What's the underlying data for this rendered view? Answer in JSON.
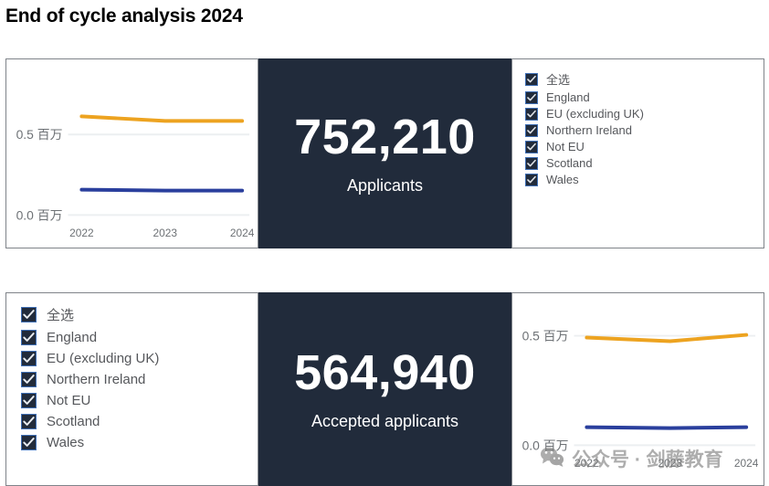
{
  "page": {
    "title": "End of cycle analysis 2024"
  },
  "kpis": [
    {
      "value": "752,210",
      "label": "Applicants"
    },
    {
      "value": "564,940",
      "label": "Accepted applicants"
    }
  ],
  "filter": {
    "items": [
      {
        "label": "全选",
        "checked": true
      },
      {
        "label": "England",
        "checked": true
      },
      {
        "label": "EU (excluding UK)",
        "checked": true
      },
      {
        "label": "Northern Ireland",
        "checked": true
      },
      {
        "label": "Not EU",
        "checked": true
      },
      {
        "label": "Scotland",
        "checked": true
      },
      {
        "label": "Wales",
        "checked": true
      }
    ]
  },
  "watermark": {
    "text": "公众号 · 剑藤教育",
    "icon": "wechat-icon"
  },
  "colors": {
    "panel_dark": "#212b3b",
    "series_applicants": "#eda320",
    "series_accepted": "#2a3f9d",
    "axis_text": "#6d7175",
    "gridline": "#eceff1"
  },
  "chart_data": [
    {
      "id": "applicants-trend",
      "type": "line",
      "title": "",
      "xlabel": "",
      "ylabel": "",
      "x": [
        "2022",
        "2023",
        "2024"
      ],
      "xtick_labels": [
        "2022",
        "2023",
        "2024"
      ],
      "ytick_labels": [
        "0.0 百万",
        "0.5 百万"
      ],
      "ytick_values": [
        0.0,
        0.5
      ],
      "ylim": [
        0.0,
        0.72
      ],
      "grid": true,
      "legend": "none",
      "series": [
        {
          "name": "Applicants",
          "color": "#eda320",
          "values": [
            0.612,
            0.596,
            0.594
          ]
        },
        {
          "name": "Accepted applicants",
          "color": "#2a3f9d",
          "values": [
            0.162,
            0.159,
            0.158
          ]
        }
      ]
    },
    {
      "id": "accepted-trend",
      "type": "line",
      "title": "",
      "xlabel": "",
      "ylabel": "",
      "x": [
        "2022",
        "2023",
        "2024"
      ],
      "xtick_labels": [
        "2022",
        "2023",
        "2024"
      ],
      "ytick_labels": [
        "0.0 百万",
        "0.5 百万"
      ],
      "ytick_values": [
        0.0,
        0.5
      ],
      "ylim": [
        0.0,
        0.58
      ],
      "grid": true,
      "legend": "none",
      "series": [
        {
          "name": "Applicants",
          "color": "#eda320",
          "values": [
            0.495,
            0.482,
            0.497
          ]
        },
        {
          "name": "Accepted applicants",
          "color": "#2a3f9d",
          "values": [
            0.112,
            0.11,
            0.111
          ]
        }
      ]
    }
  ]
}
